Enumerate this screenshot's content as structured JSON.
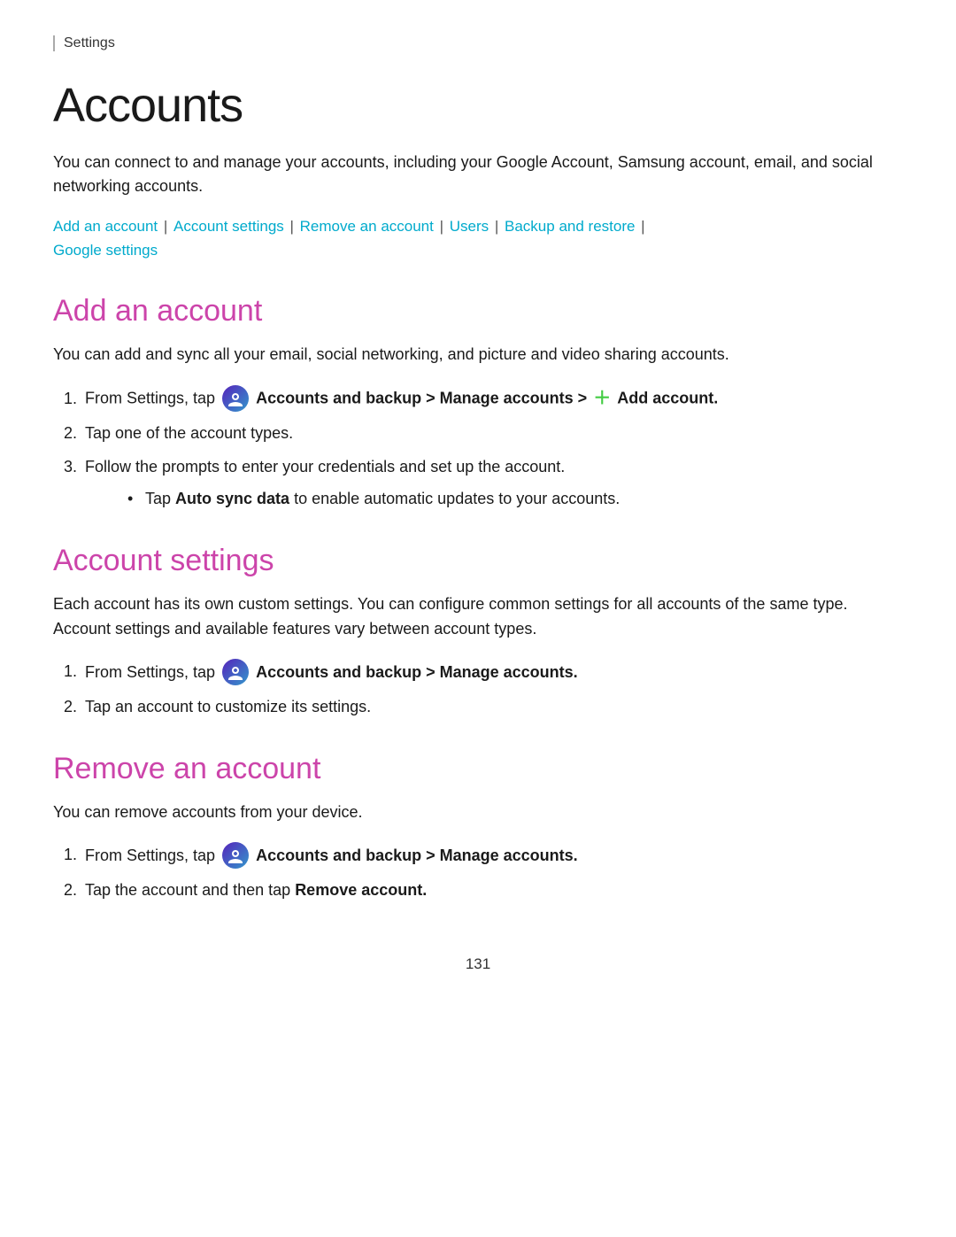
{
  "header": {
    "settings_label": "Settings"
  },
  "page": {
    "title": "Accounts",
    "intro": "You can connect to and manage your accounts, including your Google Account, Samsung account, email, and social networking accounts.",
    "page_number": "131"
  },
  "nav_links": {
    "add_account": "Add an account",
    "account_settings": "Account settings",
    "remove_account": "Remove an account",
    "users": "Users",
    "backup_restore": "Backup and restore",
    "google_settings": "Google settings"
  },
  "sections": [
    {
      "id": "add-account",
      "title": "Add an account",
      "description": "You can add and sync all your email, social networking, and picture and video sharing accounts.",
      "steps": [
        {
          "text_before": "From Settings, tap",
          "icon": "accounts-backup-icon",
          "bold_part": "Accounts and backup > Manage accounts >",
          "add_icon": true,
          "bold_end": "Add account.",
          "has_add_icon": true
        },
        {
          "text": "Tap one of the account types."
        },
        {
          "text": "Follow the prompts to enter your credentials and set up the account.",
          "bullet": "Tap Auto sync data to enable automatic updates to your accounts.",
          "bullet_bold": "Auto sync data"
        }
      ]
    },
    {
      "id": "account-settings",
      "title": "Account settings",
      "description": "Each account has its own custom settings. You can configure common settings for all accounts of the same type. Account settings and available features vary between account types.",
      "steps": [
        {
          "text_before": "From Settings, tap",
          "icon": "accounts-backup-icon",
          "bold_part": "Accounts and backup > Manage accounts."
        },
        {
          "text": "Tap an account to customize its settings."
        }
      ]
    },
    {
      "id": "remove-account",
      "title": "Remove an account",
      "description": "You can remove accounts from your device.",
      "steps": [
        {
          "text_before": "From Settings, tap",
          "icon": "accounts-backup-icon",
          "bold_part": "Accounts and backup > Manage accounts."
        },
        {
          "text_before": "Tap the account and then tap",
          "bold_end": "Remove account."
        }
      ]
    }
  ]
}
